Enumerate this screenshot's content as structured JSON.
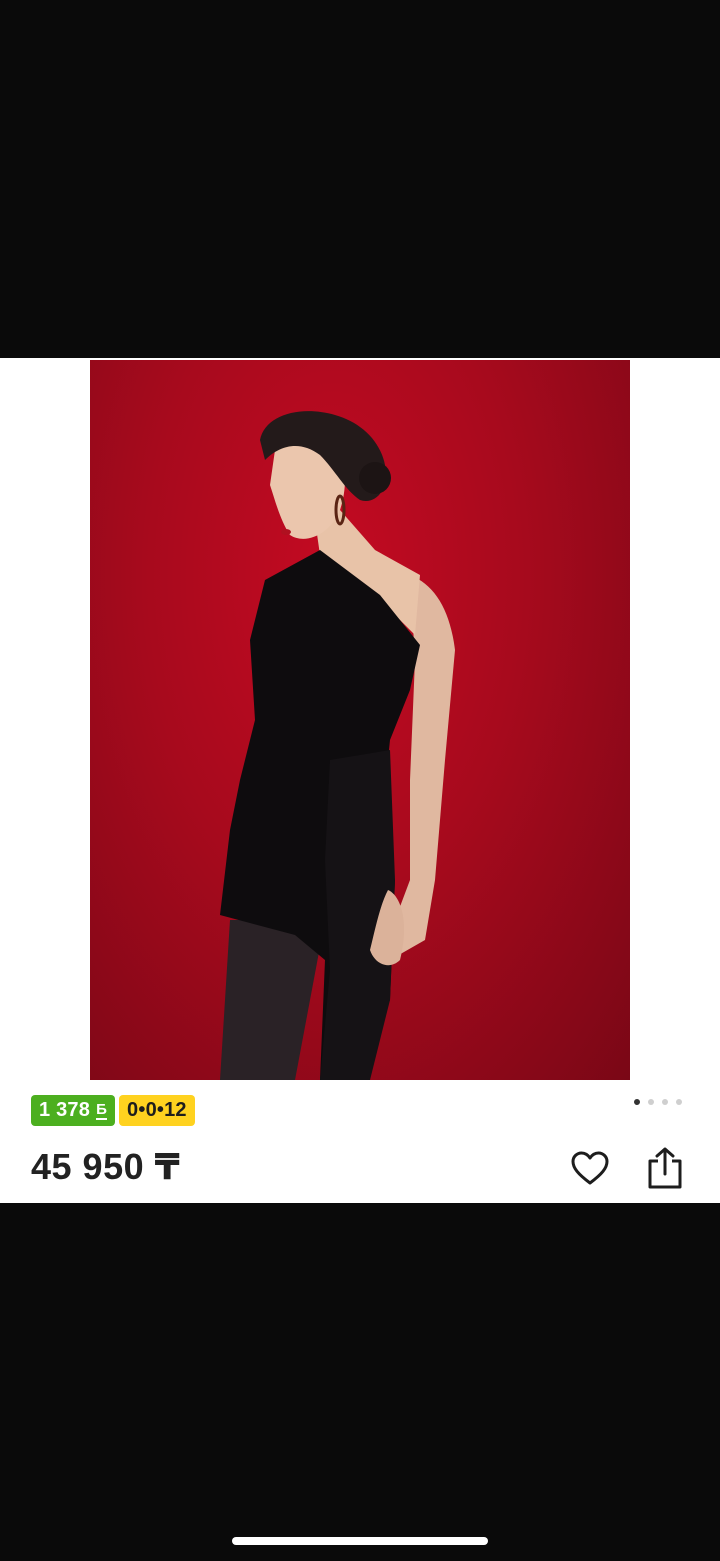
{
  "product": {
    "bonus_badge": "1 378",
    "bonus_icon": "Б",
    "installment_badge": "0•0•12",
    "price": "45 950 ₸"
  },
  "gallery": {
    "page_count": 4,
    "current_page": 1
  },
  "icons": {
    "favorite": "heart-icon",
    "share": "share-icon"
  },
  "colors": {
    "bonus_green": "#4caf1f",
    "installment_yellow": "#ffd21f",
    "price_text": "#222222",
    "photo_background": "#a70a1d"
  }
}
